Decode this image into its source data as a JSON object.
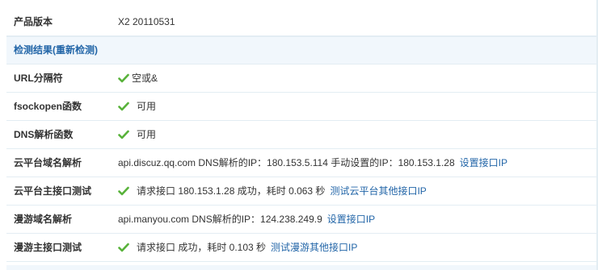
{
  "rows": [
    {
      "label": "产品版本",
      "value": "X2 20110531"
    },
    {
      "label": "URL分隔符",
      "value": "空或&"
    },
    {
      "label": "fsockopen函数",
      "value": "可用"
    },
    {
      "label": "DNS解析函数",
      "value": "可用"
    },
    {
      "label": "云平台域名解析",
      "value": "api.discuz.qq.com DNS解析的IP：180.153.5.114 手动设置的IP：180.153.1.28",
      "link": "设置接口IP"
    },
    {
      "label": "云平台主接口测试",
      "value": "请求接口 180.153.1.28 成功，耗时 0.063 秒",
      "link": "测试云平台其他接口IP"
    },
    {
      "label": "漫游域名解析",
      "value": "api.manyou.com DNS解析的IP：124.238.249.9",
      "link": "设置接口IP"
    },
    {
      "label": "漫游主接口测试",
      "value": "请求接口 成功，耗时 0.103 秒",
      "link": "测试漫游其他接口IP"
    }
  ],
  "section": {
    "title": "检测结果(重新检测)"
  },
  "icons": {
    "ok": "check-icon"
  },
  "colors": {
    "accent": "#2366a8",
    "check": "#58b23a",
    "section_bg": "#f1f7fc",
    "border": "#e3edf3"
  }
}
